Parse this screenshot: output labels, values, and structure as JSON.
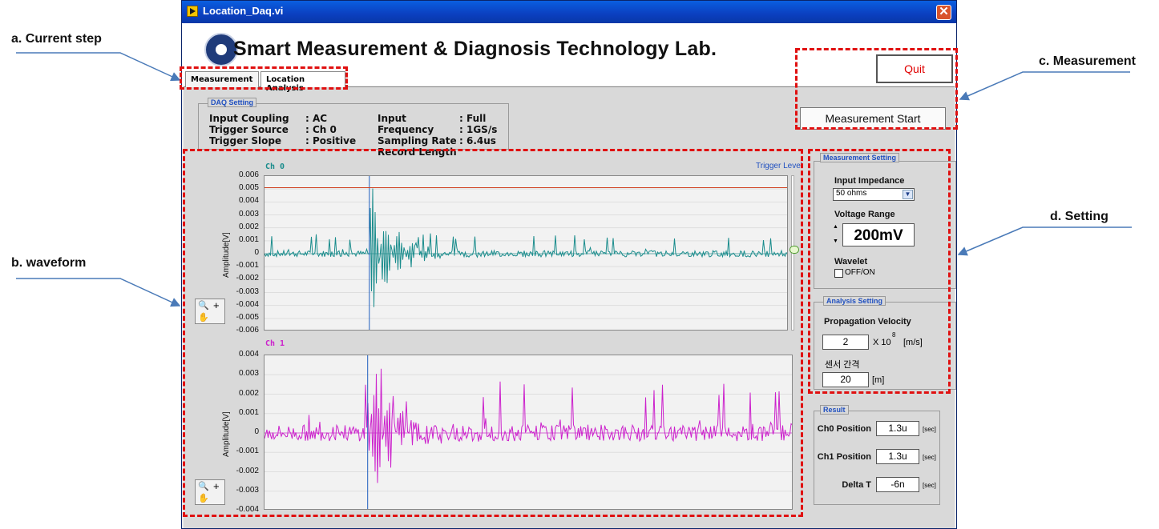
{
  "annotations": {
    "current_step": "a. Current step",
    "waveform": "b. waveform",
    "measurement": "c. Measurement",
    "setting": "d. Setting"
  },
  "window": {
    "title": "Location_Daq.vi",
    "close_glyph": "✕"
  },
  "header": {
    "lab_title": "Smart Measurement & Diagnosis Technology Lab."
  },
  "tabs": [
    {
      "label": "Measurement"
    },
    {
      "label": "Location Analysis"
    }
  ],
  "buttons": {
    "quit": "Quit",
    "start": "Measurement Start"
  },
  "daq_setting": {
    "title": "DAQ Setting",
    "rows": [
      {
        "label": "Input Coupling",
        "value": ": AC",
        "label2": "Input Frequency",
        "value2": ": Full"
      },
      {
        "label": "Trigger Source",
        "value": ": Ch 0",
        "label2": "Sampling Rate",
        "value2": ": 1GS/s"
      },
      {
        "label": "Trigger Slope",
        "value": ": Positive",
        "label2": "Record Length",
        "value2": ": 6.4us"
      }
    ]
  },
  "chart_data": [
    {
      "type": "line",
      "title": "Ch 0",
      "ylabel": "Amplitude[V]",
      "ylim": [
        -0.006,
        0.006
      ],
      "yticks": [
        "0.006",
        "0.005",
        "0.004",
        "0.003",
        "0.002",
        "0.001",
        "0",
        "-0.001",
        "-0.002",
        "-0.003",
        "-0.004",
        "-0.005",
        "-0.006"
      ],
      "trigger_label": "Trigger Level",
      "trigger_level": 0.0051,
      "color": "#1a8c8c"
    },
    {
      "type": "line",
      "title": "Ch 1",
      "ylabel": "Amplitude[V]",
      "ylim": [
        -0.004,
        0.004
      ],
      "yticks": [
        "0.004",
        "0.003",
        "0.002",
        "0.001",
        "0",
        "-0.001",
        "-0.002",
        "-0.003",
        "-0.004"
      ],
      "color": "#cc22cc"
    }
  ],
  "measurement_setting": {
    "title": "Measurement Setting",
    "impedance_label": "Input Impedance",
    "impedance_value": "50 ohms",
    "voltage_label": "Voltage Range",
    "voltage_value": "200mV",
    "wavelet_label": "Wavelet",
    "wavelet_option": "OFF/ON"
  },
  "analysis_setting": {
    "title": "Analysis Setting",
    "velocity_label": "Propagation Velocity",
    "velocity_value": "2",
    "velocity_unit_prefix": "X 10",
    "velocity_exp": "8",
    "velocity_unit": "[m/s]",
    "distance_label": "센서 간격",
    "distance_value": "20",
    "distance_unit": "[m]"
  },
  "result": {
    "title": "Result",
    "rows": [
      {
        "label": "Ch0 Position",
        "value": "1.3u",
        "unit": "[sec]"
      },
      {
        "label": "Ch1 Position",
        "value": "1.3u",
        "unit": "[sec]"
      },
      {
        "label": "Delta T",
        "value": "-6n",
        "unit": "[sec]"
      }
    ]
  },
  "colors": {
    "annotation_red": "#e01010",
    "arrow_blue": "#4a7ab8",
    "ch0": "#1a8c8c",
    "ch1": "#cc22cc"
  }
}
